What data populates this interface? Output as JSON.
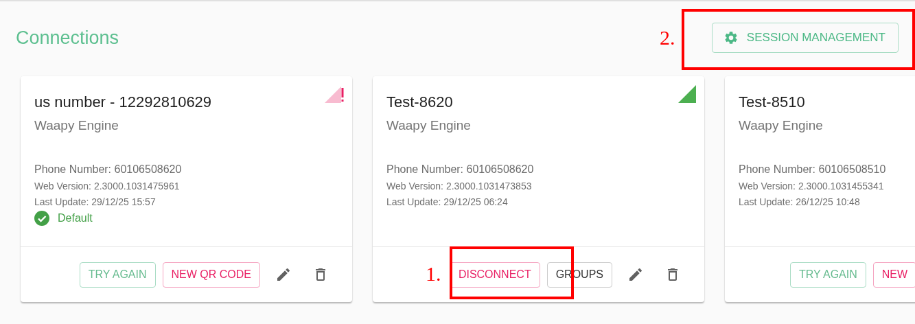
{
  "page": {
    "title": "Connections",
    "session_button": "SESSION MANAGEMENT"
  },
  "connections": [
    {
      "name": "us number - 12292810629",
      "engine": "Waapy Engine",
      "phone": "Phone Number: 60106508620",
      "web_version": "Web Version: 2.3000.1031475961",
      "last_update": "Last Update: 29/12/25 15:57",
      "connected": false,
      "default_label": "Default",
      "clipped": false,
      "buttons": [
        {
          "label": "TRY AGAIN",
          "kind": "success"
        },
        {
          "label": "NEW QR CODE",
          "kind": "danger"
        }
      ],
      "edit": true,
      "delete": true
    },
    {
      "name": "Test-8620",
      "engine": "Waapy Engine",
      "phone": "Phone Number: 60106508620",
      "web_version": "Web Version: 2.3000.1031473853",
      "last_update": "Last Update: 29/12/25 06:24",
      "connected": true,
      "clipped": false,
      "buttons": [
        {
          "label": "DISCONNECT",
          "kind": "danger"
        },
        {
          "label": "GROUPS",
          "kind": "neutral"
        }
      ],
      "edit": true,
      "delete": true
    },
    {
      "name": "Test-8510",
      "engine": "Waapy Engine",
      "phone": "Phone Number: 60106508510",
      "web_version": "Web Version: 2.3000.1031455341",
      "last_update": "Last Update: 26/12/25 10:48",
      "clipped": true,
      "buttons": [
        {
          "label": "TRY AGAIN",
          "kind": "success"
        },
        {
          "label": "NEW",
          "kind": "danger"
        }
      ]
    }
  ],
  "annotations": [
    {
      "label": "1."
    },
    {
      "label": "2."
    }
  ]
}
